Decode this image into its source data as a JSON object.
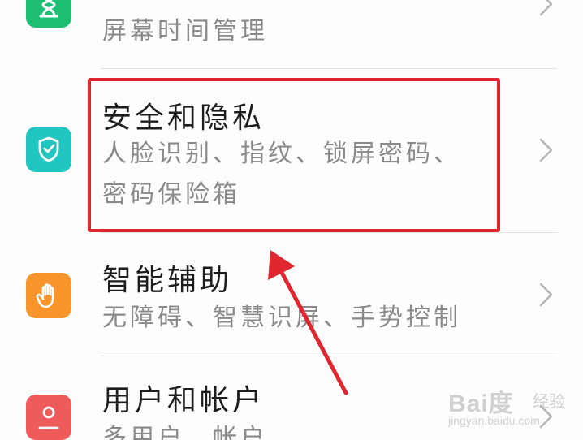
{
  "settings_list": [
    {
      "id": "screen-time",
      "title": "",
      "subtitle": "屏幕时间管理",
      "icon": "hourglass-icon",
      "icon_color": "#1dbf73"
    },
    {
      "id": "security-privacy",
      "title": "安全和隐私",
      "subtitle_line1": "人脸识别、指纹、锁屏密码、",
      "subtitle_line2": "密码保险箱",
      "icon": "shield-check-icon",
      "icon_color": "#22c6c0"
    },
    {
      "id": "smart-assist",
      "title": "智能辅助",
      "subtitle": "无障碍、智慧识屏、手势控制",
      "icon": "hand-icon",
      "icon_color": "#f7952c"
    },
    {
      "id": "users-accounts",
      "title": "用户和帐户",
      "subtitle": "多用户、帐户",
      "icon": "user-icon",
      "icon_color": "#ef5a5a"
    }
  ],
  "annotation": {
    "highlight_color": "#e0262e",
    "highlighted_item": "security-privacy"
  },
  "watermark": {
    "logo_text": "Bai度",
    "logo_cn": "经验",
    "site": "jingyan.baidu.com"
  }
}
